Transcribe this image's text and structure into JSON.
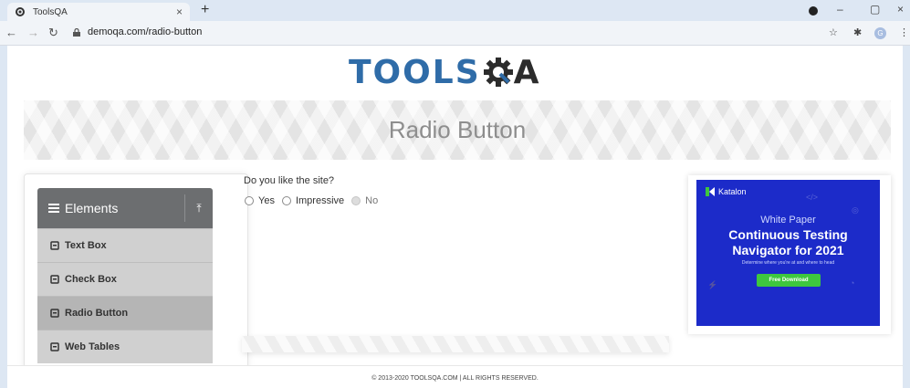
{
  "browser": {
    "tab_title": "ToolsQA",
    "tab_close": "×",
    "new_tab": "+",
    "url": "demoqa.com/radio-button",
    "minimize": "–",
    "maximize": "▢",
    "close": "×",
    "profile_initial": "G"
  },
  "header": {
    "logo_left": "TOOLS",
    "logo_right": "A"
  },
  "banner": {
    "title": "Radio Button"
  },
  "sidebar": {
    "group_label": "Elements",
    "items": [
      {
        "label": "Text Box"
      },
      {
        "label": "Check Box"
      },
      {
        "label": "Radio Button"
      },
      {
        "label": "Web Tables"
      }
    ]
  },
  "main": {
    "question": "Do you like the site?",
    "options": [
      {
        "label": "Yes",
        "disabled": false
      },
      {
        "label": "Impressive",
        "disabled": false
      },
      {
        "label": "No",
        "disabled": true
      }
    ]
  },
  "ad": {
    "brand": "Katalon",
    "subtitle": "White Paper",
    "headline_1": "Continuous Testing",
    "headline_2": "Navigator for 2021",
    "tagline": "Determine where you're at and where to head",
    "button": "Free Download",
    "colors": {
      "background": "#1c2bc9",
      "button": "#3ec73e"
    }
  },
  "footer": {
    "text": "© 2013-2020 TOOLSQA.COM | ALL RIGHTS RESERVED."
  }
}
